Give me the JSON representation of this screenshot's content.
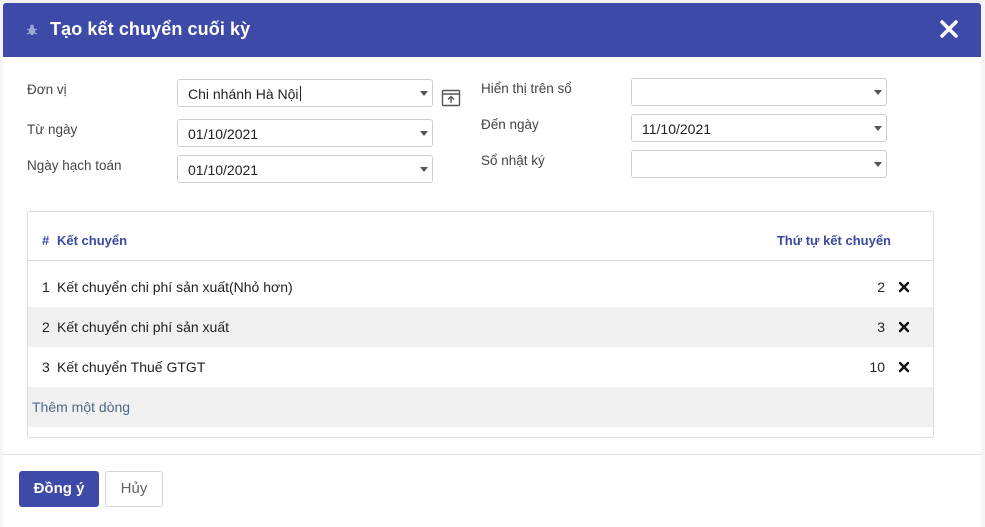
{
  "dialog": {
    "title": "Tạo kết chuyển cuối kỳ"
  },
  "form": {
    "don_vi_label": "Đơn vị",
    "don_vi_value": "Chi nhánh Hà Nội",
    "tu_ngay_label": "Từ ngày",
    "tu_ngay_value": "01/10/2021",
    "ngay_hach_toan_label": "Ngày hạch toán",
    "ngay_hach_toan_value": "01/10/2021",
    "hien_thi_label": "Hiển thị trên sổ",
    "hien_thi_value": "",
    "den_ngay_label": "Đến ngày",
    "den_ngay_value": "11/10/2021",
    "so_nhat_ky_label": "Sổ nhật ký",
    "so_nhat_ky_value": ""
  },
  "table": {
    "col_num": "#",
    "col_name": "Kết chuyển",
    "col_order": "Thứ tự kết chuyển",
    "rows": [
      {
        "num": "1",
        "name": "Kết chuyển chi phí sản xuất(Nhỏ hơn)",
        "order": "2"
      },
      {
        "num": "2",
        "name": "Kết chuyển chi phí sản xuất",
        "order": "3"
      },
      {
        "num": "3",
        "name": "Kết chuyển Thuế GTGT",
        "order": "10"
      }
    ],
    "add_row": "Thêm một dòng"
  },
  "footer": {
    "ok_label": "Đồng ý",
    "cancel_label": "Hủy"
  },
  "colors": {
    "header_bg": "#3d4aa8",
    "primary_button": "#3d4aa8",
    "table_header_text": "#3a48a0"
  },
  "icons": {
    "header": "bug-icon",
    "close": "close-icon",
    "open": "open-external-icon",
    "delete": "delete-x-icon"
  }
}
